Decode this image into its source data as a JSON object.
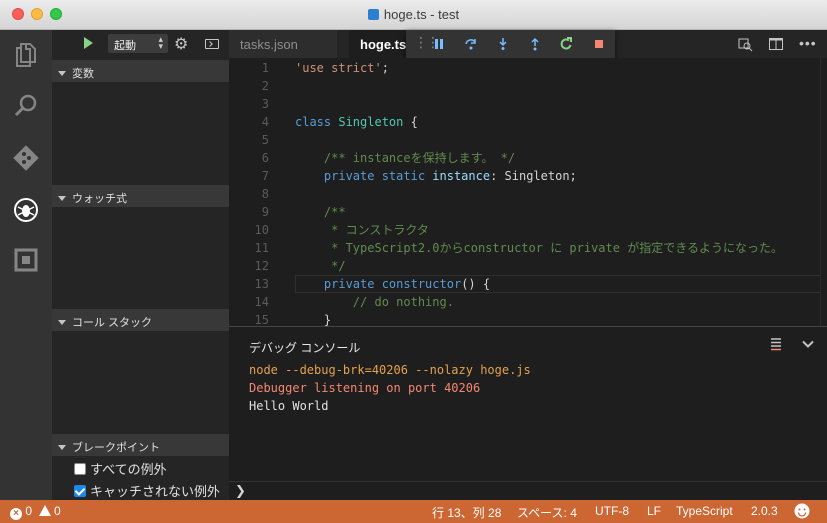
{
  "window": {
    "title": "hoge.ts - test"
  },
  "debug_sidebar": {
    "config_select": "起動",
    "sections": {
      "variables": "変数",
      "watch": "ウォッチ式",
      "call_stack": "コール スタック",
      "breakpoints": "ブレークポイント"
    },
    "breakpoints": [
      {
        "label": "すべての例外",
        "checked": false
      },
      {
        "label": "キャッチされない例外",
        "checked": true
      }
    ]
  },
  "tabs": [
    {
      "label": "tasks.json",
      "active": false
    },
    {
      "label": "hoge.ts",
      "active": true
    }
  ],
  "editor": {
    "lines": [
      {
        "n": "1",
        "tokens": [
          [
            "s",
            "'use strict'"
          ],
          [
            "w",
            ";"
          ]
        ]
      },
      {
        "n": "2",
        "tokens": []
      },
      {
        "n": "3",
        "tokens": []
      },
      {
        "n": "4",
        "tokens": [
          [
            "k",
            "class "
          ],
          [
            "cls",
            "Singleton"
          ],
          [
            "w",
            " {"
          ]
        ]
      },
      {
        "n": "5",
        "tokens": []
      },
      {
        "n": "6",
        "tokens": [
          [
            "c",
            "    /** instanceを保持します。 */"
          ]
        ]
      },
      {
        "n": "7",
        "tokens": [
          [
            "k",
            "    private static "
          ],
          [
            "p",
            "instance"
          ],
          [
            "w",
            ": Singleton;"
          ]
        ]
      },
      {
        "n": "8",
        "tokens": []
      },
      {
        "n": "9",
        "tokens": [
          [
            "c",
            "    /**"
          ]
        ]
      },
      {
        "n": "10",
        "tokens": [
          [
            "c",
            "     * コンストラクタ"
          ]
        ]
      },
      {
        "n": "11",
        "tokens": [
          [
            "c",
            "     * TypeScript2.0からconstructor に private が指定できるようになった。"
          ]
        ]
      },
      {
        "n": "12",
        "tokens": [
          [
            "c",
            "     */"
          ]
        ]
      },
      {
        "n": "13",
        "tokens": [
          [
            "k",
            "    private "
          ],
          [
            "k",
            "constructor"
          ],
          [
            "w",
            "() {"
          ]
        ]
      },
      {
        "n": "14",
        "tokens": [
          [
            "c",
            "        // do nothing."
          ]
        ]
      },
      {
        "n": "15",
        "tokens": [
          [
            "w",
            "    }"
          ]
        ]
      }
    ]
  },
  "panel": {
    "title": "デバッグ コンソール",
    "output": [
      {
        "text": "node --debug-brk=40206 --nolazy hoge.js",
        "color": "#e5a14d"
      },
      {
        "text": "Debugger listening on port 40206",
        "color": "#f48771"
      },
      {
        "text": "Hello World",
        "color": "#e0e0e0"
      }
    ],
    "prompt": "❯"
  },
  "statusbar": {
    "errors": "0",
    "warnings": "0",
    "cursor": "行 13、列 28",
    "indent": "スペース: 4",
    "encoding": "UTF-8",
    "eol": "LF",
    "language": "TypeScript",
    "version": "2.0.3",
    "background": "#cc6633"
  }
}
